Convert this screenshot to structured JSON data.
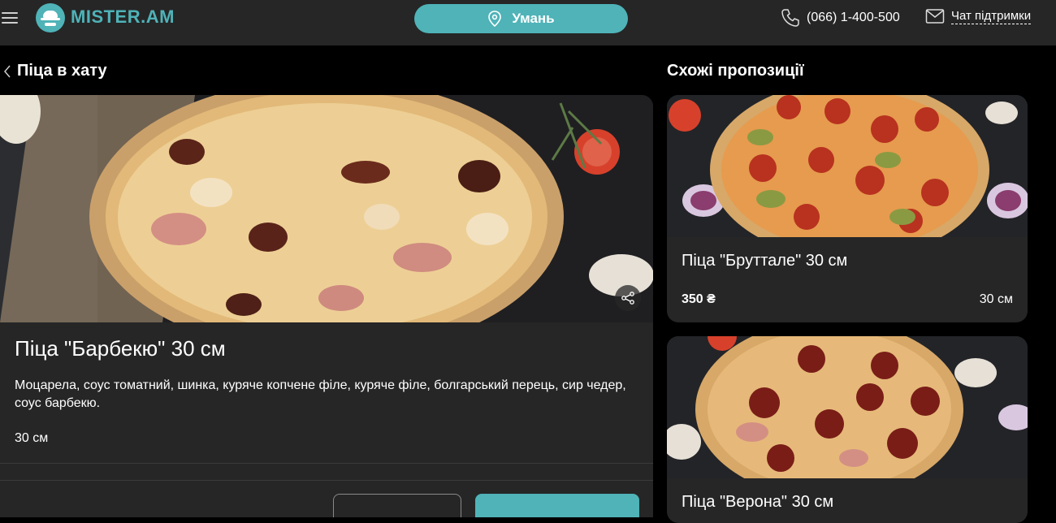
{
  "header": {
    "logo_text": "MISTER.AM",
    "city": "Умань",
    "phone": "(066) 1-400-500",
    "chat": "Чат підтримки"
  },
  "breadcrumb": {
    "back_label": "Піца в хату"
  },
  "product": {
    "title": "Піца \"Барбекю\" 30 см",
    "description": "Моцарела, соус томатний, шинка, куряче копчене філе, куряче філе, болгарський перець, сир чедер, соус барбекю.",
    "size": "30 см"
  },
  "similar": {
    "title": "Схожі пропозиції",
    "items": [
      {
        "name": "Піца \"Бруттале\" 30 см",
        "price": "350 ₴",
        "size": "30 см"
      },
      {
        "name": "Піца \"Верона\" 30 см",
        "price": "",
        "size": ""
      }
    ]
  },
  "colors": {
    "accent": "#4fb3b8",
    "panel": "#262626",
    "background": "#000000"
  }
}
